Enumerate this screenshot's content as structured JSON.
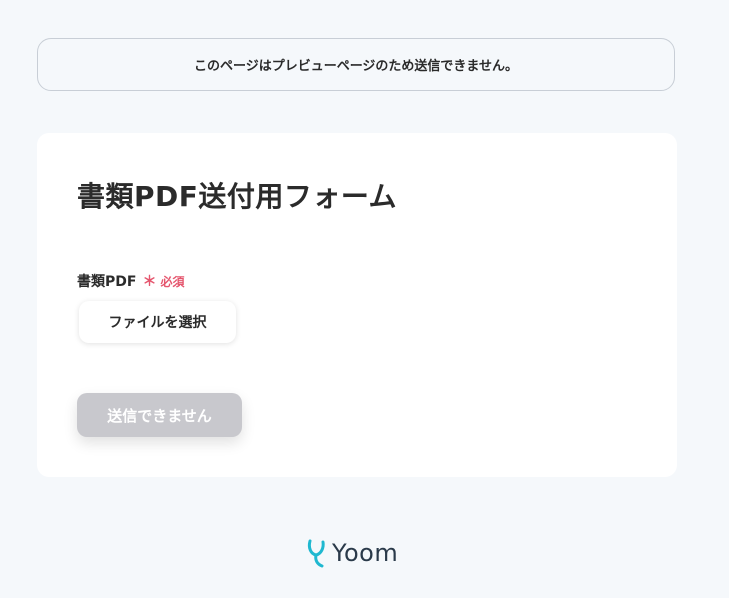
{
  "banner": {
    "text": "このページはプレビューページのため送信できません。"
  },
  "form": {
    "title": "書類PDF送付用フォーム",
    "field": {
      "label": "書類PDF",
      "required_mark": "＊",
      "required_text": "必須",
      "file_button_label": "ファイルを選択"
    },
    "submit_label": "送信できません"
  },
  "footer": {
    "logo_icon": "yoom-logo-icon",
    "logo_text": "Yoom"
  },
  "colors": {
    "background": "#f5f8fb",
    "required": "#e5566e",
    "submit_disabled": "#c8c8cd",
    "logo_accent": "#1fb8d0"
  }
}
